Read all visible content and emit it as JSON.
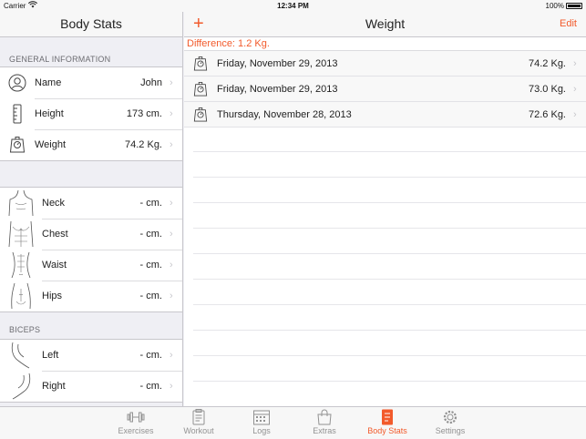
{
  "status_bar": {
    "carrier": "Carrier",
    "time": "12:34 PM",
    "battery": "100%"
  },
  "left_panel": {
    "title": "Body Stats",
    "general_header": "GENERAL INFORMATION",
    "general": [
      {
        "label": "Name",
        "value": "John",
        "icon": "person-icon"
      },
      {
        "label": "Height",
        "value": "173 cm.",
        "icon": "ruler-icon"
      },
      {
        "label": "Weight",
        "value": "74.2 Kg.",
        "icon": "scale-icon"
      }
    ],
    "body": [
      {
        "label": "Neck",
        "value": "- cm.",
        "icon": "neck-figure-icon"
      },
      {
        "label": "Chest",
        "value": "- cm.",
        "icon": "chest-figure-icon"
      },
      {
        "label": "Waist",
        "value": "- cm.",
        "icon": "waist-figure-icon"
      },
      {
        "label": "Hips",
        "value": "- cm.",
        "icon": "hips-figure-icon"
      }
    ],
    "biceps_header": "BICEPS",
    "biceps": [
      {
        "label": "Left",
        "value": "- cm.",
        "icon": "left-arm-icon"
      },
      {
        "label": "Right",
        "value": "- cm.",
        "icon": "right-arm-icon"
      }
    ]
  },
  "right_panel": {
    "add_label": "+",
    "title": "Weight",
    "edit_label": "Edit",
    "difference": "Difference: 1.2 Kg.",
    "entries": [
      {
        "date": "Friday, November 29, 2013",
        "value": "74.2 Kg."
      },
      {
        "date": "Friday, November 29, 2013",
        "value": "73.0 Kg."
      },
      {
        "date": "Thursday, November 28, 2013",
        "value": "72.6 Kg."
      }
    ]
  },
  "tabs": [
    {
      "label": "Exercises",
      "icon": "dumbbell-icon",
      "active": false
    },
    {
      "label": "Workout",
      "icon": "clipboard-icon",
      "active": false
    },
    {
      "label": "Logs",
      "icon": "calendar-icon",
      "active": false
    },
    {
      "label": "Extras",
      "icon": "shopping-bag-icon",
      "active": false
    },
    {
      "label": "Body Stats",
      "icon": "body-stats-icon",
      "active": true
    },
    {
      "label": "Settings",
      "icon": "gear-icon",
      "active": false
    }
  ],
  "colors": {
    "accent": "#f25a2b",
    "inactive_tab": "#929292",
    "chevron": "#c7c7cc",
    "background": "#efeff4"
  }
}
